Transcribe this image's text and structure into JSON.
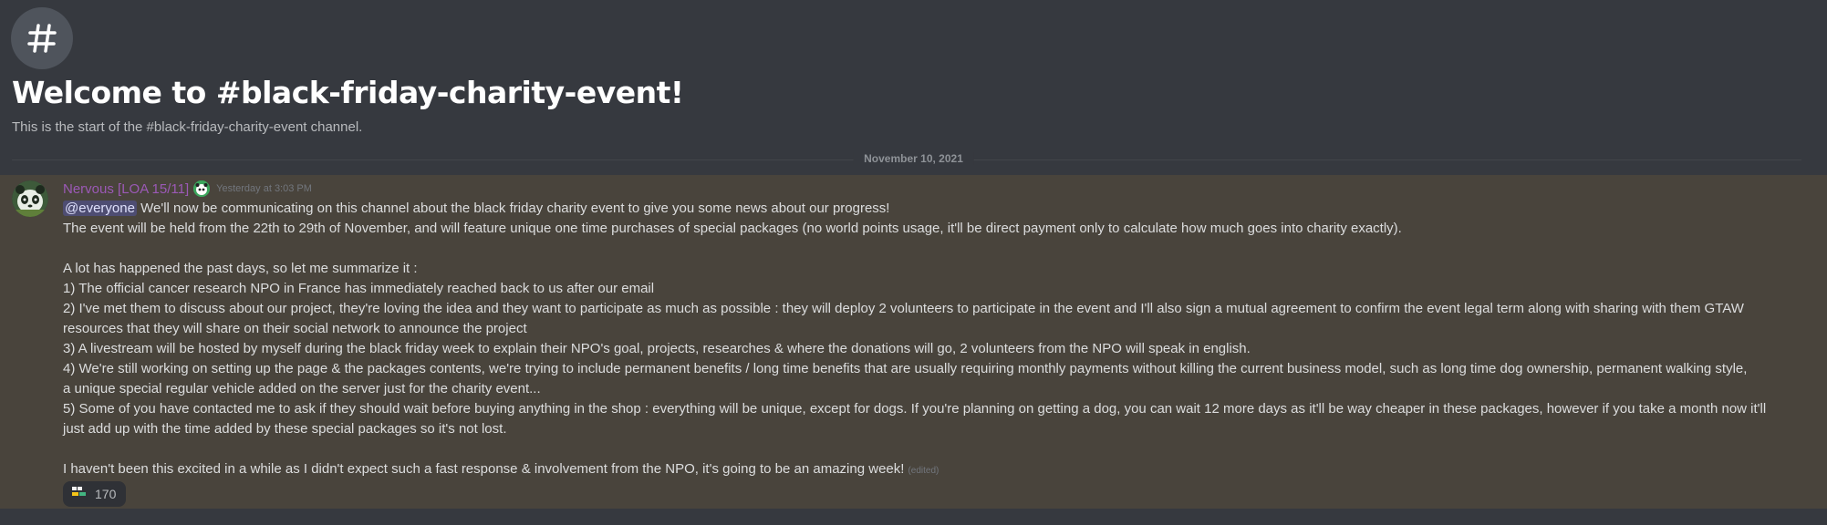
{
  "channel": {
    "icon": "hash-icon",
    "welcome_title": "Welcome to #black-friday-charity-event!",
    "welcome_subtitle": "This is the start of the #black-friday-charity-event channel."
  },
  "divider": {
    "date": "November 10, 2021"
  },
  "message": {
    "author": "Nervous [LOA 15/11]",
    "author_color": "#9b59b6",
    "timestamp": "Yesterday at 3:03 PM",
    "mention": "@everyone",
    "line1_rest": " We'll now be communicating on this channel about the black friday charity event to give you some news about our progress!",
    "line2": "The event will be held from the 22th to 29th of November, and will feature unique one time purchases of special packages (no world points usage, it'll be direct payment only to calculate how much goes into charity exactly).",
    "line3": "A lot has happened the past days, so let me summarize it :",
    "line4": "1) The official cancer research NPO in France has immediately reached back to us after our email",
    "line5": "2) I've met them to discuss about our project, they're loving the idea and they want to participate as much as possible : they will deploy 2 volunteers to participate in the event and I'll also sign a mutual agreement to confirm the event legal term along with sharing with them GTAW",
    "line6": "resources that they will share on their social network to announce the project",
    "line7": "3) A livestream will be hosted by myself during the black friday week to explain their NPO's goal, projects, researches & where the donations will go, 2 volunteers from the NPO will speak in english.",
    "line8": "4) We're still working on setting up the page & the packages contents, we're trying to include permanent benefits / long time benefits that are usually requiring monthly payments without killing the current business model, such as long time dog ownership, permanent walking style,",
    "line9": "a unique special regular vehicle added on the server just for the charity event...",
    "line10": "5) Some of you have contacted me to ask if they should wait before buying anything in the shop : everything will be unique, except for dogs. If you're planning on getting a dog, you can wait 12 more days as it'll be way cheaper in these packages, however if you take a month now it'll",
    "line11": "just add up with the time added by these special packages so it's not lost.",
    "line12": "I haven't been this excited in a while as I didn't expect such a fast response & involvement from the NPO, it's going to be an amazing week!",
    "edited": "(edited)",
    "reaction_count": "170"
  }
}
